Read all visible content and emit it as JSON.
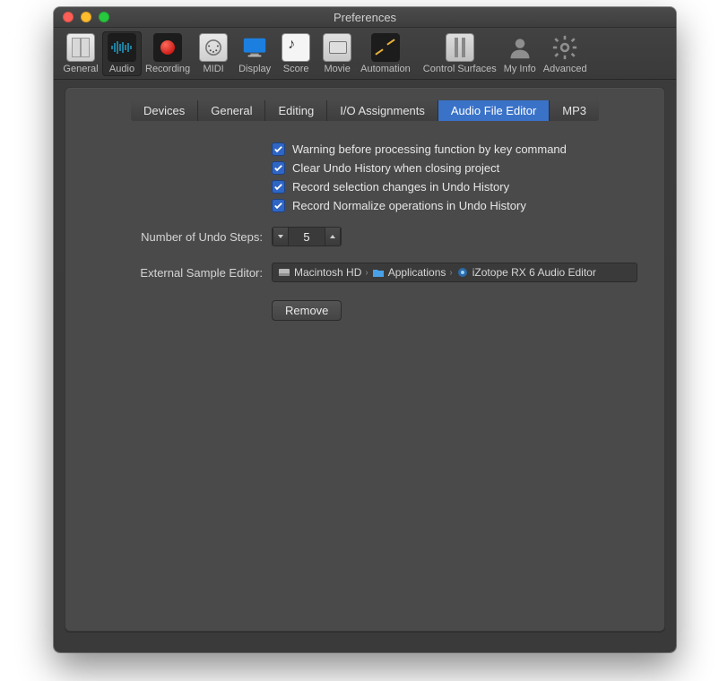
{
  "window": {
    "title": "Preferences"
  },
  "toolbar": {
    "items": [
      {
        "label": "General"
      },
      {
        "label": "Audio"
      },
      {
        "label": "Recording"
      },
      {
        "label": "MIDI"
      },
      {
        "label": "Display"
      },
      {
        "label": "Score"
      },
      {
        "label": "Movie"
      },
      {
        "label": "Automation"
      },
      {
        "label": "Control Surfaces"
      },
      {
        "label": "My Info"
      },
      {
        "label": "Advanced"
      }
    ],
    "selected": "Audio"
  },
  "tabs": {
    "items": [
      "Devices",
      "General",
      "Editing",
      "I/O Assignments",
      "Audio File Editor",
      "MP3"
    ],
    "active": "Audio File Editor"
  },
  "checks": [
    {
      "label": "Warning before processing function by key command",
      "checked": true
    },
    {
      "label": "Clear Undo History when closing project",
      "checked": true
    },
    {
      "label": "Record selection changes in Undo History",
      "checked": true
    },
    {
      "label": "Record Normalize operations in Undo History",
      "checked": true
    }
  ],
  "undo_steps": {
    "label": "Number of Undo Steps:",
    "value": "5"
  },
  "external_editor": {
    "label": "External Sample Editor:",
    "path": [
      "Macintosh HD",
      "Applications",
      "iZotope RX 6 Audio Editor"
    ]
  },
  "buttons": {
    "remove": "Remove"
  }
}
